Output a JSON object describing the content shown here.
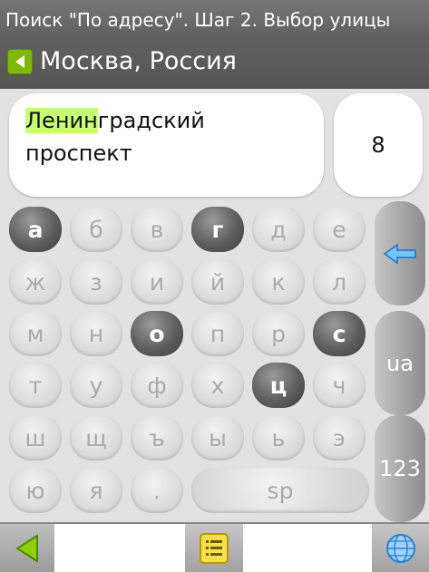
{
  "header": {
    "title": "Поиск \"По адресу\". Шаг 2. Выбор улицы",
    "city": "Москва, Россия"
  },
  "search": {
    "street_match": "Ленин",
    "street_rest_line1": "градский",
    "street_line2": "проспект",
    "house_number": "8"
  },
  "keyboard": {
    "row1": [
      "а",
      "б",
      "в",
      "г",
      "д",
      "е"
    ],
    "row2": [
      "ж",
      "з",
      "и",
      "й",
      "к",
      "л"
    ],
    "row3": [
      "м",
      "н",
      "о",
      "п",
      "р",
      "с"
    ],
    "row4": [
      "т",
      "у",
      "ф",
      "х",
      "ц",
      "ч"
    ],
    "row5": [
      "ш",
      "щ",
      "ъ",
      "ы",
      "ь",
      "э"
    ],
    "row6": [
      "ю",
      "я",
      "."
    ],
    "space_label": "sp",
    "layout_label": "ua",
    "numeric_label": "123",
    "active_keys": [
      "а",
      "г",
      "о",
      "с",
      "ц"
    ]
  },
  "colors": {
    "accent_green": "#7fb800",
    "highlight": "#c8ff6f",
    "globe_blue": "#2a7fd8"
  },
  "icons": {
    "back": "triangle-left-icon",
    "backspace": "arrow-left-icon",
    "list": "list-icon",
    "globe": "globe-icon"
  }
}
